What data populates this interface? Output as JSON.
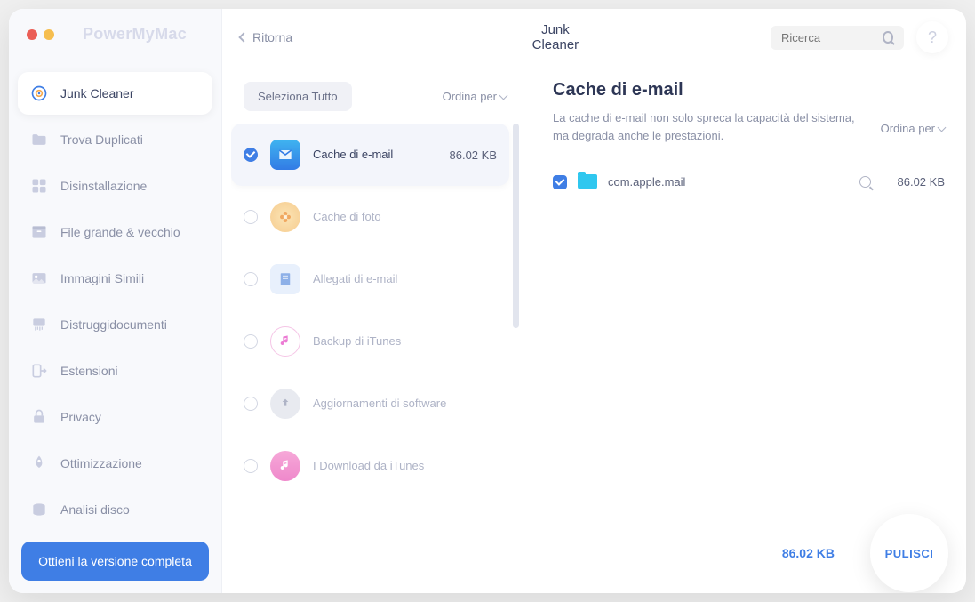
{
  "app_title": "PowerMyMac",
  "back_label": "Ritorna",
  "section_title": "Junk Cleaner",
  "search_placeholder": "Ricerca",
  "help_symbol": "?",
  "sidebar": {
    "items": [
      {
        "label": "Junk Cleaner"
      },
      {
        "label": "Trova Duplicati"
      },
      {
        "label": "Disinstallazione"
      },
      {
        "label": "File grande & vecchio"
      },
      {
        "label": "Immagini Simili"
      },
      {
        "label": "Distruggidocumenti"
      },
      {
        "label": "Estensioni"
      },
      {
        "label": "Privacy"
      },
      {
        "label": "Ottimizzazione"
      },
      {
        "label": "Analisi disco"
      }
    ],
    "cta": "Ottieni la versione completa"
  },
  "categories": {
    "select_all": "Seleziona Tutto",
    "order_by": "Ordina per",
    "items": [
      {
        "label": "Cache di e-mail",
        "size": "86.02 KB"
      },
      {
        "label": "Cache di foto",
        "size": ""
      },
      {
        "label": "Allegati di e-mail",
        "size": ""
      },
      {
        "label": "Backup di iTunes",
        "size": ""
      },
      {
        "label": "Aggiornamenti di software",
        "size": ""
      },
      {
        "label": "I Download da iTunes",
        "size": ""
      }
    ]
  },
  "details": {
    "title": "Cache di e-mail",
    "description": "La cache di e-mail non solo spreca la capacità del sistema, ma degrada anche le prestazioni.",
    "order_by": "Ordina per",
    "files": [
      {
        "name": "com.apple.mail",
        "size": "86.02 KB"
      }
    ]
  },
  "footer": {
    "total": "86.02 KB",
    "clean": "PULISCI"
  }
}
